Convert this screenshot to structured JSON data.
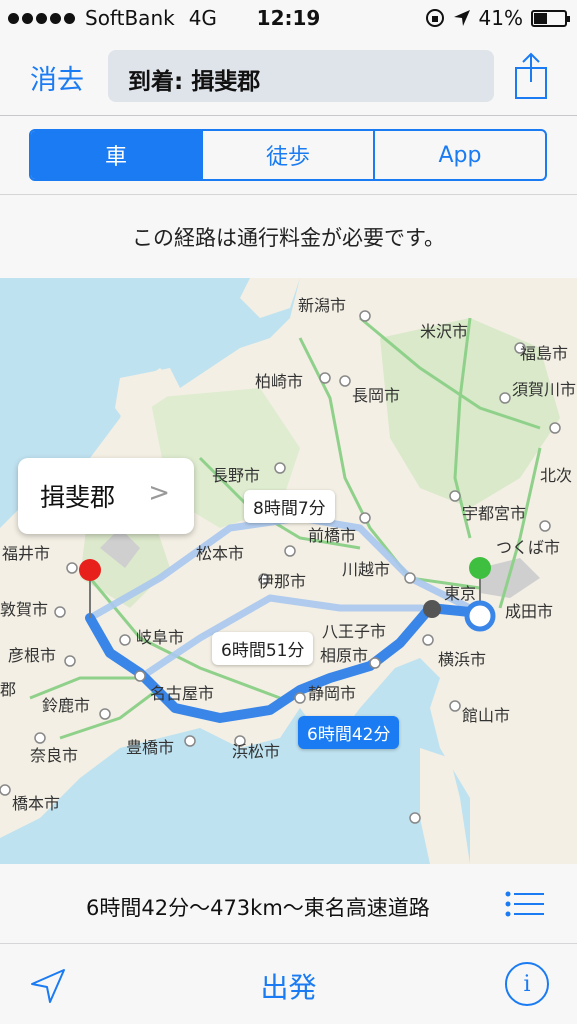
{
  "status": {
    "carrier": "SoftBank",
    "network": "4G",
    "time": "12:19",
    "battery": "41%"
  },
  "nav": {
    "cancel_label": "消去",
    "destination": "到着: 揖斐郡"
  },
  "segments": {
    "items": [
      "車",
      "徒歩",
      "App"
    ],
    "selected": "車"
  },
  "notice": "この経路は通行料金が必要です。",
  "map": {
    "callout_title": "揖斐郡",
    "route_times": {
      "alt1": "8時間7分",
      "alt2": "6時間51分",
      "selected": "6時間42分"
    },
    "labels": {
      "niigata": "新潟市",
      "yonezawa": "米沢市",
      "fukushima": "福島市",
      "kashiwazaki": "柏崎市",
      "nagaoka": "長岡市",
      "sukagawa": "須賀川市",
      "kitaku": "北次",
      "nagano": "長野市",
      "utsunomiya": "宇都宮市",
      "tsukuba": "つくば市",
      "maebashi": "前橋市",
      "fukui": "福井市",
      "matsumoto": "松本市",
      "kawagoe": "川越市",
      "ina": "伊那市",
      "tokyo": "東京",
      "narita": "成田市",
      "tsuruga": "敦賀市",
      "hachioji": "八王子市",
      "gifu": "岐阜市",
      "sagamihara": "相原市",
      "yokohama": "横浜市",
      "hikone": "彦根市",
      "nagoya": "名古屋市",
      "shizuoka": "静岡市",
      "suzuka": "鈴鹿市",
      "tateyama": "館山市",
      "toyohashi": "豊橋市",
      "hamamatsu": "浜松市",
      "nara": "奈良市",
      "hashimoto": "橋本市",
      "partial": "郡"
    }
  },
  "summary": "6時間42分〜473km〜東名高速道路",
  "tabbar": {
    "start_label": "出発",
    "info_label": "i"
  },
  "colors": {
    "accent": "#1a7bf2",
    "route": "#3a86e8",
    "alt_route": "#a9c8ef",
    "start_pin": "#3fbf3f",
    "end_pin": "#e8201c"
  }
}
